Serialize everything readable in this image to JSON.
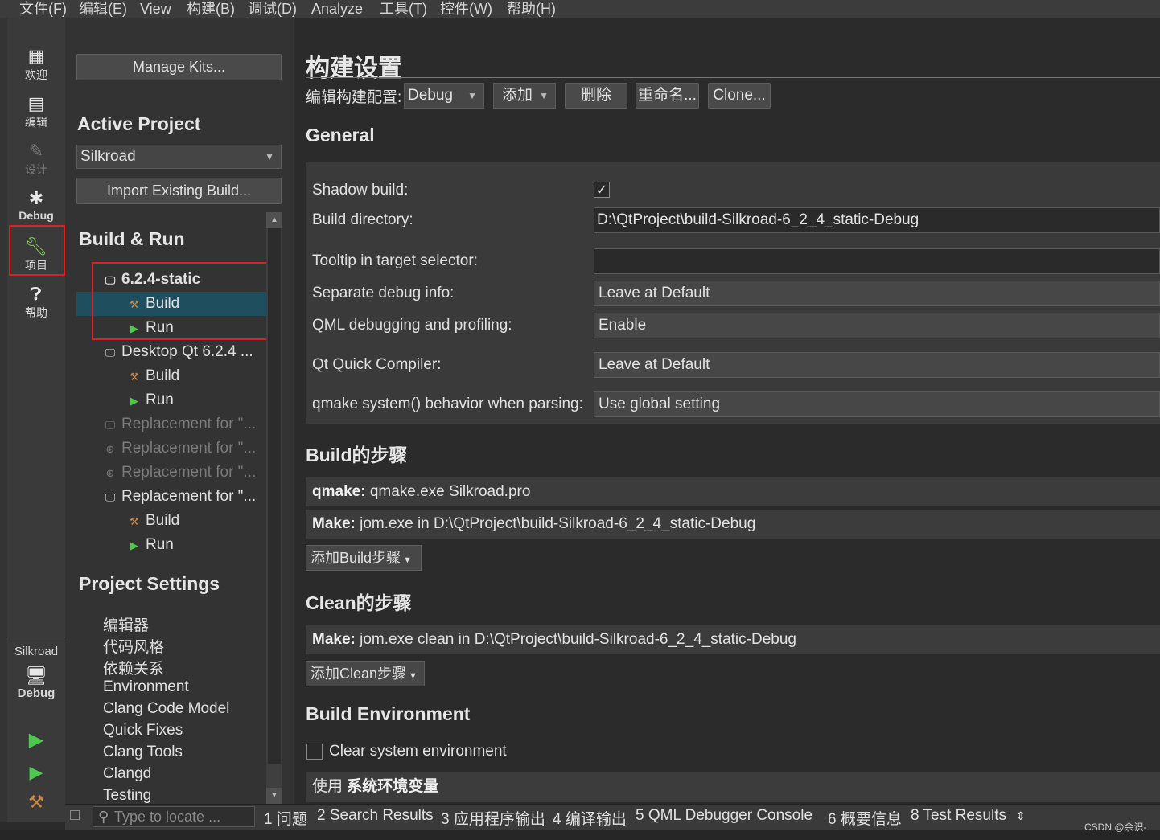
{
  "menubar": {
    "items": [
      "文件(F)",
      "编辑(E)",
      "View",
      "构建(B)",
      "调试(D)",
      "Analyze",
      "工具(T)",
      "控件(W)",
      "帮助(H)"
    ]
  },
  "modebar": {
    "modes": [
      {
        "label": "欢迎",
        "icon": "grid-icon"
      },
      {
        "label": "编辑",
        "icon": "document-icon"
      },
      {
        "label": "设计",
        "icon": "pencil-icon"
      },
      {
        "label": "Debug",
        "icon": "bug-icon"
      },
      {
        "label": "项目",
        "icon": "wrench-icon"
      },
      {
        "label": "帮助",
        "icon": "help-icon"
      }
    ],
    "target_project": "Silkroad",
    "target_config": "Debug"
  },
  "leftpane": {
    "manage_kits": "Manage Kits...",
    "active_project_title": "Active Project",
    "active_project_value": "Silkroad",
    "import_build": "Import Existing Build...",
    "build_run_title": "Build & Run",
    "tree": [
      {
        "label": "6.2.4-static",
        "kind": "kit",
        "bold": true
      },
      {
        "label": "Build",
        "kind": "build",
        "selected": true
      },
      {
        "label": "Run",
        "kind": "run"
      },
      {
        "label": "Desktop Qt 6.2.4 ...",
        "kind": "kit"
      },
      {
        "label": "Build",
        "kind": "build"
      },
      {
        "label": "Run",
        "kind": "run"
      },
      {
        "label": "Replacement for \"...",
        "kind": "kit",
        "dim": true
      },
      {
        "label": "Replacement for \"...",
        "kind": "kit",
        "dim": true
      },
      {
        "label": "Replacement for \"...",
        "kind": "kit",
        "dim": true
      },
      {
        "label": "Replacement for \"...",
        "kind": "kit"
      },
      {
        "label": "Build",
        "kind": "build"
      },
      {
        "label": "Run",
        "kind": "run"
      }
    ],
    "project_settings_title": "Project Settings",
    "project_settings": [
      "编辑器",
      "代码风格",
      "依赖关系",
      "Environment",
      "Clang Code Model",
      "Quick Fixes",
      "Clang Tools",
      "Clangd",
      "Testing"
    ]
  },
  "buildsettings": {
    "title": "构建设置",
    "edit_config_label": "编辑构建配置:",
    "config_value": "Debug",
    "add_label": "添加",
    "delete_label": "删除",
    "rename_label": "重命名...",
    "clone_label": "Clone...",
    "general_title": "General",
    "shadow_build_label": "Shadow build:",
    "shadow_build_checked": true,
    "build_dir_label": "Build directory:",
    "build_dir_value": "D:\\QtProject\\build-Silkroad-6_2_4_static-Debug",
    "tooltip_label": "Tooltip in target selector:",
    "tooltip_value": "",
    "sep_debug_label": "Separate debug info:",
    "sep_debug_value": "Leave at Default",
    "qml_debug_label": "QML debugging and profiling:",
    "qml_debug_value": "Enable",
    "qtquick_label": "Qt Quick Compiler:",
    "qtquick_value": "Leave at Default",
    "qmake_sys_label": "qmake system() behavior when parsing:",
    "qmake_sys_value": "Use global setting",
    "build_steps_title": "Build的步骤",
    "qmake_step_key": "qmake:",
    "qmake_step_val": "qmake.exe Silkroad.pro",
    "make_step_key": "Make:",
    "make_step_val": "jom.exe in D:\\QtProject\\build-Silkroad-6_2_4_static-Debug",
    "add_build_step": "添加Build步骤",
    "clean_steps_title": "Clean的步骤",
    "clean_make_key": "Make:",
    "clean_make_val": "jom.exe clean in D:\\QtProject\\build-Silkroad-6_2_4_static-Debug",
    "add_clean_step": "添加Clean步骤",
    "build_env_title": "Build Environment",
    "clear_env_label": "Clear system environment",
    "use_env_prefix": "使用",
    "use_env_bold": "系统环境变量"
  },
  "bottombar": {
    "locator_placeholder": "Type to locate ...",
    "tabs": [
      "1 问题",
      "2 Search Results",
      "3 应用程序输出",
      "4 编译输出",
      "5 QML Debugger Console",
      "6 概要信息",
      "8 Test Results"
    ],
    "watermark": "CSDN @余识-"
  },
  "colors": {
    "highlight_box": "#e02020",
    "selected_row": "#1f4e5f",
    "run_icon": "#4fc84f",
    "build_icon": "#c88a4b"
  }
}
